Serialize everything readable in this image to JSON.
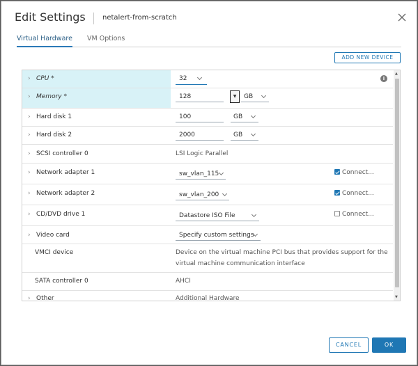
{
  "dialog": {
    "title": "Edit Settings",
    "subtitle": "netalert-from-scratch",
    "tabs": [
      "Virtual Hardware",
      "VM Options"
    ],
    "add_device_label": "ADD NEW DEVICE",
    "cancel_label": "CANCEL",
    "ok_label": "OK"
  },
  "rows": {
    "cpu": {
      "label": "CPU *",
      "value": "32"
    },
    "memory": {
      "label": "Memory *",
      "value": "128",
      "unit": "GB"
    },
    "hd1": {
      "label": "Hard disk 1",
      "value": "100",
      "unit": "GB"
    },
    "hd2": {
      "label": "Hard disk 2",
      "value": "2000",
      "unit": "GB"
    },
    "scsi": {
      "label": "SCSI controller 0",
      "value": "LSI Logic Parallel"
    },
    "net1": {
      "label": "Network adapter 1",
      "value": "sw_vlan_115",
      "connect": "Connect...",
      "connected": true
    },
    "net2": {
      "label": "Network adapter 2",
      "value": "sw_vlan_200",
      "connect": "Connect...",
      "connected": true
    },
    "cd": {
      "label": "CD/DVD drive 1",
      "value": "Datastore ISO File",
      "connect": "Connect...",
      "connected": false
    },
    "video": {
      "label": "Video card",
      "value": "Specify custom settings"
    },
    "vmci": {
      "label": "VMCI device",
      "line1": "Device on the virtual machine PCI bus that provides support for the",
      "line2": "virtual machine communication interface"
    },
    "sata": {
      "label": "SATA controller 0",
      "value": "AHCI"
    },
    "other": {
      "label": "Other",
      "value": "Additional Hardware"
    }
  },
  "colors": {
    "accent": "#1f77b4",
    "highlight": "#d8f2f7"
  }
}
